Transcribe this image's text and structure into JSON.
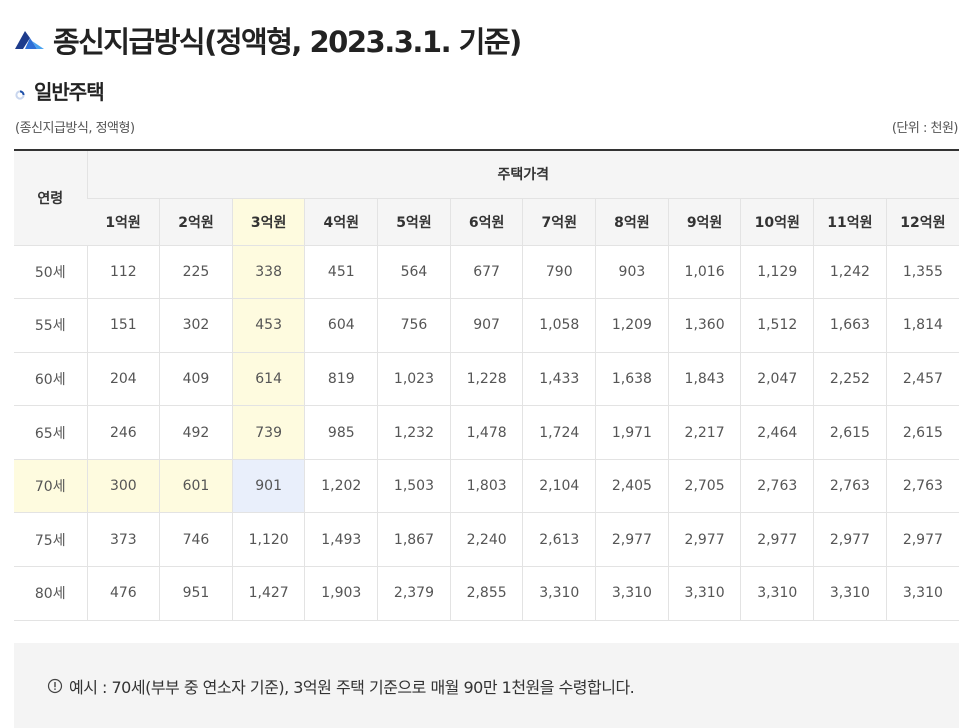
{
  "header": {
    "title": "종신지급방식(정액형, 2023.3.1. 기준)",
    "title_icon": "mountain-logo-icon",
    "section_title": "일반주택",
    "section_icon": "bullet-icon"
  },
  "captions": {
    "left": "(종신지급방식, 정액형)",
    "right": "(단위 : 천원)"
  },
  "table": {
    "age_header": "연령",
    "price_header": "주택가격",
    "columns": [
      "1억원",
      "2억원",
      "3억원",
      "4억원",
      "5억원",
      "6억원",
      "7억원",
      "8억원",
      "9억원",
      "10억원",
      "11억원",
      "12억원"
    ],
    "rows": [
      {
        "age": "50세",
        "values": [
          "112",
          "225",
          "338",
          "451",
          "564",
          "677",
          "790",
          "903",
          "1,016",
          "1,129",
          "1,242",
          "1,355"
        ]
      },
      {
        "age": "55세",
        "values": [
          "151",
          "302",
          "453",
          "604",
          "756",
          "907",
          "1,058",
          "1,209",
          "1,360",
          "1,512",
          "1,663",
          "1,814"
        ]
      },
      {
        "age": "60세",
        "values": [
          "204",
          "409",
          "614",
          "819",
          "1,023",
          "1,228",
          "1,433",
          "1,638",
          "1,843",
          "2,047",
          "2,252",
          "2,457"
        ]
      },
      {
        "age": "65세",
        "values": [
          "246",
          "492",
          "739",
          "985",
          "1,232",
          "1,478",
          "1,724",
          "1,971",
          "2,217",
          "2,464",
          "2,615",
          "2,615"
        ]
      },
      {
        "age": "70세",
        "values": [
          "300",
          "601",
          "901",
          "1,202",
          "1,503",
          "1,803",
          "2,104",
          "2,405",
          "2,705",
          "2,763",
          "2,763",
          "2,763"
        ]
      },
      {
        "age": "75세",
        "values": [
          "373",
          "746",
          "1,120",
          "1,493",
          "1,867",
          "2,240",
          "2,613",
          "2,977",
          "2,977",
          "2,977",
          "2,977",
          "2,977"
        ]
      },
      {
        "age": "80세",
        "values": [
          "476",
          "951",
          "1,427",
          "1,903",
          "2,379",
          "2,855",
          "3,310",
          "3,310",
          "3,310",
          "3,310",
          "3,310",
          "3,310"
        ]
      }
    ],
    "highlight": {
      "column_index": 2,
      "row_index": 4,
      "column_color": "#fefbdf",
      "row_color": "#fefbdf",
      "intersection_color": "#e9effb"
    }
  },
  "note": {
    "icon": "info-circle-icon",
    "text": "예시 : 70세(부부 중 연소자 기준), 3억원 주택 기준으로 매월 90만 1천원을 수령합니다."
  }
}
